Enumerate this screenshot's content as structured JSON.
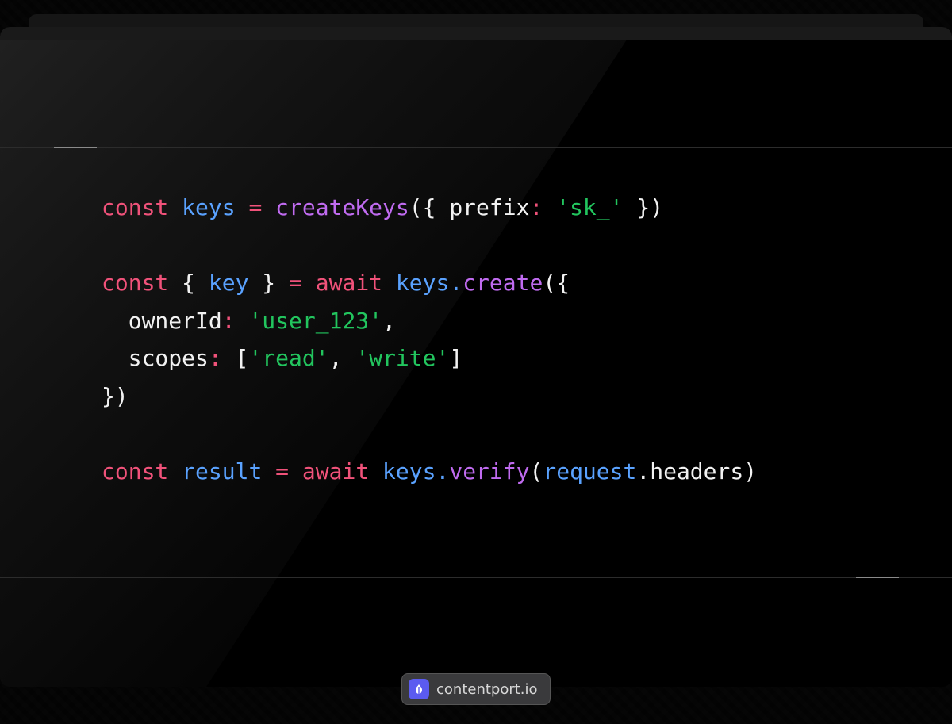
{
  "code": {
    "lines": [
      [
        {
          "t": "const",
          "k": "keyword"
        },
        {
          "t": " ",
          "k": "punc"
        },
        {
          "t": "keys",
          "k": "var"
        },
        {
          "t": " ",
          "k": "punc"
        },
        {
          "t": "=",
          "k": "op"
        },
        {
          "t": " ",
          "k": "punc"
        },
        {
          "t": "createKeys",
          "k": "func"
        },
        {
          "t": "({ ",
          "k": "punc"
        },
        {
          "t": "prefix",
          "k": "prop"
        },
        {
          "t": ":",
          "k": "op"
        },
        {
          "t": " ",
          "k": "punc"
        },
        {
          "t": "'sk_'",
          "k": "string"
        },
        {
          "t": " })",
          "k": "punc"
        }
      ],
      [],
      [
        {
          "t": "const",
          "k": "keyword"
        },
        {
          "t": " { ",
          "k": "punc"
        },
        {
          "t": "key",
          "k": "var"
        },
        {
          "t": " } ",
          "k": "punc"
        },
        {
          "t": "=",
          "k": "op"
        },
        {
          "t": " ",
          "k": "punc"
        },
        {
          "t": "await",
          "k": "keyword"
        },
        {
          "t": " ",
          "k": "punc"
        },
        {
          "t": "keys",
          "k": "var"
        },
        {
          "t": ".",
          "k": "var"
        },
        {
          "t": "create",
          "k": "func"
        },
        {
          "t": "({",
          "k": "punc"
        }
      ],
      [
        {
          "t": "  ownerId",
          "k": "prop"
        },
        {
          "t": ":",
          "k": "op"
        },
        {
          "t": " ",
          "k": "punc"
        },
        {
          "t": "'user_123'",
          "k": "string"
        },
        {
          "t": ",",
          "k": "punc"
        }
      ],
      [
        {
          "t": "  scopes",
          "k": "prop"
        },
        {
          "t": ":",
          "k": "op"
        },
        {
          "t": " [",
          "k": "punc"
        },
        {
          "t": "'read'",
          "k": "string"
        },
        {
          "t": ", ",
          "k": "punc"
        },
        {
          "t": "'write'",
          "k": "string"
        },
        {
          "t": "]",
          "k": "punc"
        }
      ],
      [
        {
          "t": "})",
          "k": "punc"
        }
      ],
      [],
      [
        {
          "t": "const",
          "k": "keyword"
        },
        {
          "t": " ",
          "k": "punc"
        },
        {
          "t": "result",
          "k": "var"
        },
        {
          "t": " ",
          "k": "punc"
        },
        {
          "t": "=",
          "k": "op"
        },
        {
          "t": " ",
          "k": "punc"
        },
        {
          "t": "await",
          "k": "keyword"
        },
        {
          "t": " ",
          "k": "punc"
        },
        {
          "t": "keys",
          "k": "var"
        },
        {
          "t": ".",
          "k": "var"
        },
        {
          "t": "verify",
          "k": "func"
        },
        {
          "t": "(",
          "k": "punc"
        },
        {
          "t": "request",
          "k": "var"
        },
        {
          "t": ".headers)",
          "k": "punc"
        }
      ]
    ]
  },
  "watermark": {
    "label": "contentport.io",
    "icon": "contentport-logo-icon"
  },
  "colors": {
    "keyword": "#f0527a",
    "variable": "#5aa2ff",
    "function": "#c06bf0",
    "string": "#22c55e",
    "text": "#f2f2f2",
    "badge_accent": "#5b5bf0"
  }
}
